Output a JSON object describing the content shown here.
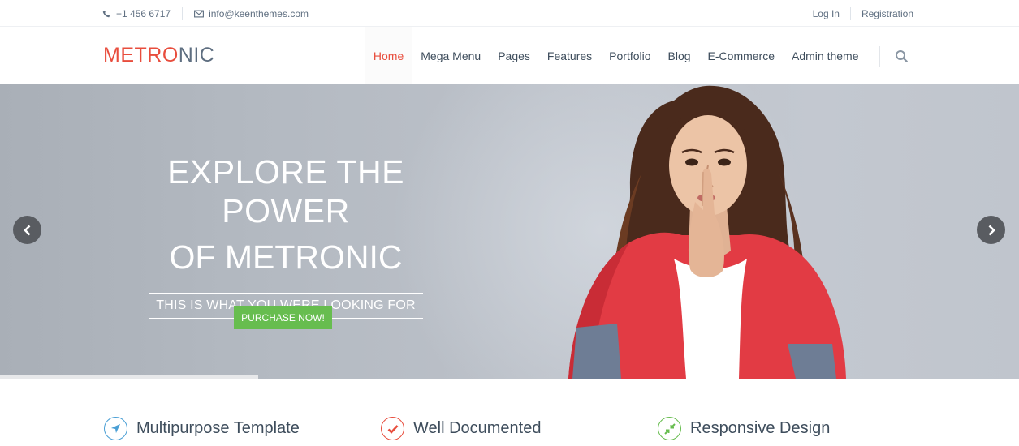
{
  "topbar": {
    "phone": "+1 456 6717",
    "email": "info@keenthemes.com",
    "login": "Log In",
    "registration": "Registration"
  },
  "header": {
    "logo_part1": "METRO",
    "logo_part2": "NIC",
    "nav": [
      "Home",
      "Mega Menu",
      "Pages",
      "Features",
      "Portfolio",
      "Blog",
      "E-Commerce",
      "Admin theme"
    ],
    "active_nav": "Home"
  },
  "hero": {
    "title_line1": "EXPLORE THE POWER",
    "title_line2": "OF METRONIC",
    "subtitle": "THIS IS WHAT YOU WERE LOOKING FOR",
    "button": "PURCHASE NOW!"
  },
  "features": [
    {
      "label": "Multipurpose Template",
      "icon": "location-arrow-icon",
      "color": "#4a9fd5"
    },
    {
      "label": "Well Documented",
      "icon": "check-icon",
      "color": "#e84d3d"
    },
    {
      "label": "Responsive Design",
      "icon": "compress-icon",
      "color": "#67bd4f"
    }
  ],
  "colors": {
    "accent": "#e84d3d",
    "button_green": "#67bd4f",
    "text": "#3e4d5c"
  }
}
